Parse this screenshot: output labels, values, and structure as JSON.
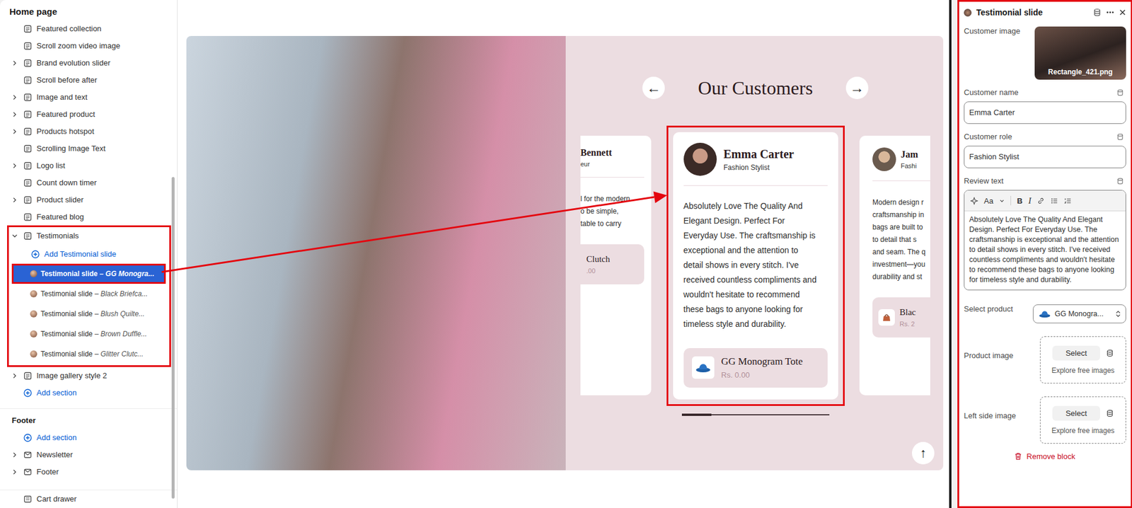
{
  "sidebar": {
    "title": "Home page",
    "sections": [
      {
        "label": "Featured collection",
        "expandable": false,
        "expanded": false
      },
      {
        "label": "Scroll zoom video image",
        "expandable": false,
        "expanded": false
      },
      {
        "label": "Brand evolution slider",
        "expandable": true,
        "expanded": false
      },
      {
        "label": "Scroll before after",
        "expandable": false,
        "expanded": false
      },
      {
        "label": "Image and text",
        "expandable": true,
        "expanded": false
      },
      {
        "label": "Featured product",
        "expandable": true,
        "expanded": false
      },
      {
        "label": "Products hotspot",
        "expandable": true,
        "expanded": false
      },
      {
        "label": "Scrolling Image Text",
        "expandable": false,
        "expanded": false
      },
      {
        "label": "Logo list",
        "expandable": true,
        "expanded": false
      },
      {
        "label": "Count down timer",
        "expandable": false,
        "expanded": false
      },
      {
        "label": "Product slider",
        "expandable": true,
        "expanded": false
      },
      {
        "label": "Featured blog",
        "expandable": false,
        "expanded": false
      },
      {
        "label": "Testimonials",
        "expandable": true,
        "expanded": true,
        "add_block": "Add Testimonial slide",
        "blocks": [
          {
            "label": "Testimonial slide",
            "detail": "– GG Monogra...",
            "selected": true
          },
          {
            "label": "Testimonial slide",
            "detail": "– Black Briefca...",
            "selected": false
          },
          {
            "label": "Testimonial slide",
            "detail": "– Blush Quilte...",
            "selected": false
          },
          {
            "label": "Testimonial slide",
            "detail": "– Brown Duffle...",
            "selected": false
          },
          {
            "label": "Testimonial slide",
            "detail": "– Glitter Clutc...",
            "selected": false
          }
        ]
      },
      {
        "label": "Image gallery style 2",
        "expandable": true,
        "expanded": false
      }
    ],
    "add_section": "Add section",
    "footer": {
      "title": "Footer",
      "add_section": "Add section",
      "sections": [
        {
          "label": "Newsletter",
          "expandable": true,
          "expanded": false
        },
        {
          "label": "Footer",
          "expandable": true,
          "expanded": false
        }
      ]
    },
    "cart_drawer": "Cart drawer"
  },
  "preview": {
    "heading": "Our Customers",
    "prev": "←",
    "next": "→",
    "scroll_top": "↑",
    "progress": {
      "level": 0.2
    },
    "cards": [
      {
        "kind": "left",
        "selected": false,
        "name": "Bennett",
        "role": "eur",
        "review_lines": [
          "l for the modern",
          "o be simple,",
          "table to carry"
        ],
        "product": "Clutch",
        "price": ".00"
      },
      {
        "kind": "full",
        "selected": true,
        "name": "Emma Carter",
        "role": "Fashion Stylist",
        "review_lines": [
          "Absolutely Love The Quality And",
          "Elegant Design. Perfect For",
          "Everyday Use. The craftsmanship is",
          "exceptional and the attention to",
          "detail shows in every stitch. I've",
          "received countless compliments and",
          "wouldn't hesitate to recommend",
          "these bags to anyone looking for",
          "timeless style and durability."
        ],
        "product": "GG Monogram Tote",
        "price": "Rs. 0.00"
      },
      {
        "kind": "right",
        "selected": false,
        "name": "Jam",
        "role": "Fashi",
        "review_lines": [
          "Modern design r",
          "craftsmanship in",
          "bags are built to",
          "to detail that s",
          "and seam. The q",
          "investment—you",
          "durability and st"
        ],
        "product": "Blac",
        "price": "Rs. 2"
      }
    ]
  },
  "panel": {
    "title": "Testimonial slide",
    "image_field": {
      "label": "Customer image",
      "filename": "Rectangle_421.png"
    },
    "text_fields": [
      {
        "label": "Customer name",
        "value": "Emma Carter"
      },
      {
        "label": "Customer role",
        "value": "Fashion Stylist"
      }
    ],
    "review": {
      "label": "Review text",
      "toolbar": [
        "Aa",
        "B",
        "I"
      ],
      "value": "Absolutely Love The Quality And Elegant Design. Perfect For Everyday Use. The craftsmanship is exceptional and the attention to detail shows in every stitch. I've received countless compliments and wouldn't hesitate to recommend these bags to anyone looking for timeless style and durability."
    },
    "product_select": {
      "label": "Select product",
      "value": "GG Monogra..."
    },
    "pickers": [
      {
        "label": "Product image",
        "button": "Select",
        "hint": "Explore free images"
      },
      {
        "label": "Left side image",
        "button": "Select",
        "hint": "Explore free images"
      }
    ],
    "remove": "Remove block"
  }
}
